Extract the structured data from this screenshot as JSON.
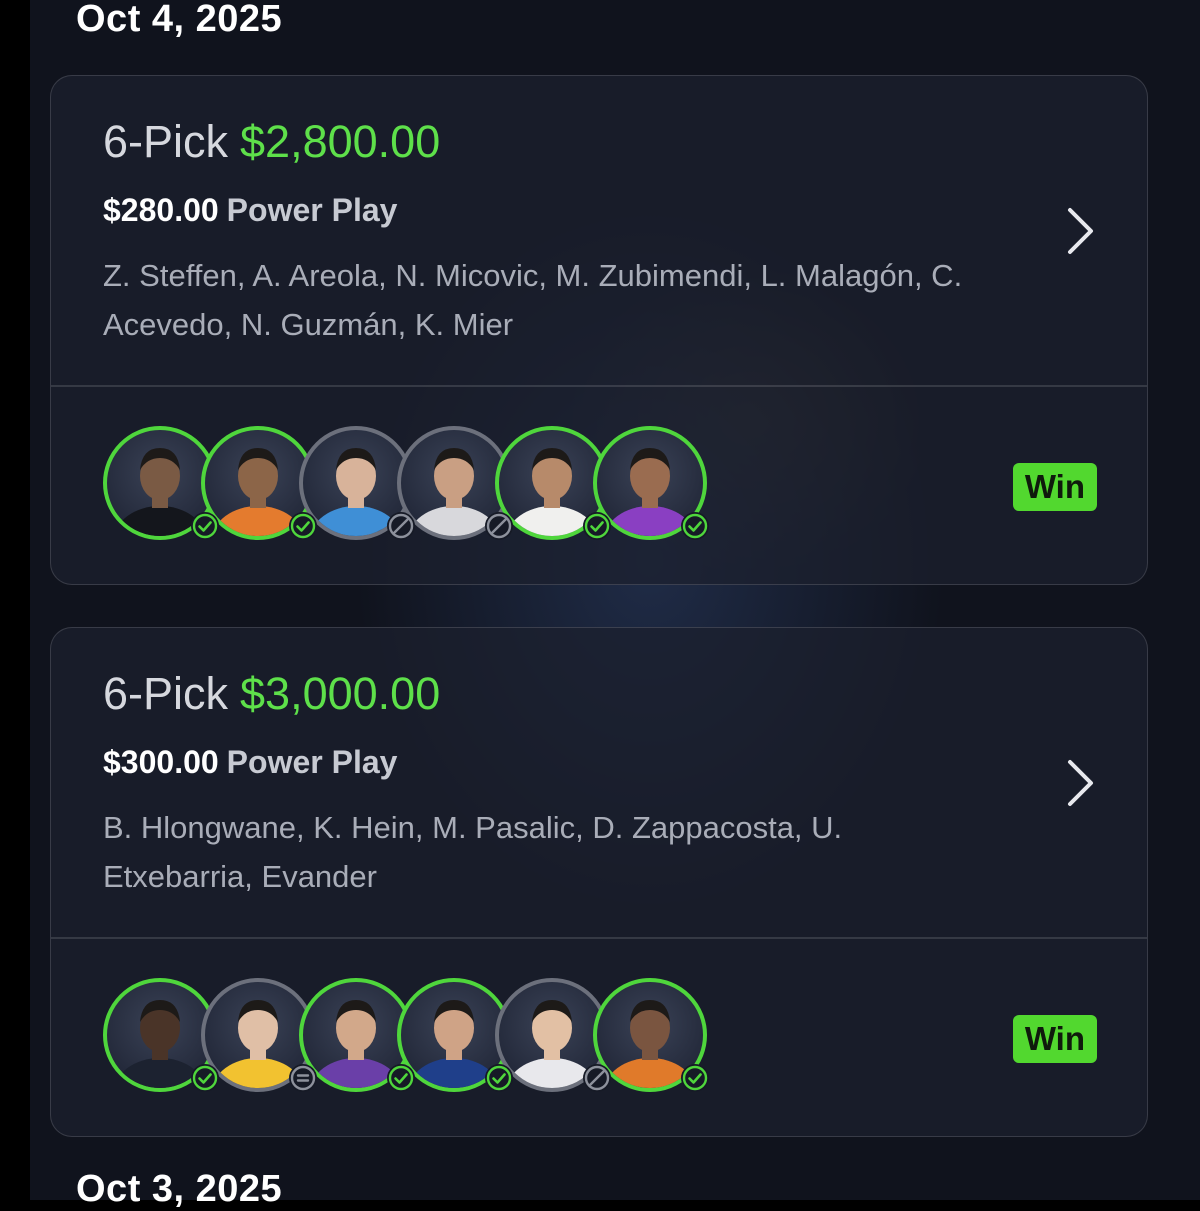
{
  "date_heading": "Oct 4, 2025",
  "next_date_heading": "Oct 3, 2025",
  "colors": {
    "accent_green": "#5ee04a",
    "win_badge": "#52d82f",
    "background": "#10131d"
  },
  "cards": [
    {
      "pick_label": "6-Pick",
      "payout": "$2,800.00",
      "entry_amount": "$280.00",
      "entry_type": "Power Play",
      "players": "Z. Steffen, A. Areola, N. Micovic, M. Zubimendi, L. Malagón, C. Acevedo, N. Guzmán, K. Mier",
      "result": "Win",
      "avatars": [
        {
          "status": "win",
          "ring": "green",
          "skin": "#7a5a44",
          "jersey": "#14161c"
        },
        {
          "status": "win",
          "ring": "green",
          "skin": "#8c6548",
          "jersey": "#e47b2e"
        },
        {
          "status": "void",
          "ring": "grey",
          "skin": "#d8b39a",
          "jersey": "#3f8fd6"
        },
        {
          "status": "void",
          "ring": "grey",
          "skin": "#c99f83",
          "jersey": "#d8d8dc"
        },
        {
          "status": "win",
          "ring": "green",
          "skin": "#b78a6a",
          "jersey": "#f0f0ee"
        },
        {
          "status": "win",
          "ring": "green",
          "skin": "#9a6c50",
          "jersey": "#8a3fc2"
        }
      ]
    },
    {
      "pick_label": "6-Pick",
      "payout": "$3,000.00",
      "entry_amount": "$300.00",
      "entry_type": "Power Play",
      "players": "B. Hlongwane, K. Hein, M. Pasalic, D. Zappacosta, U. Etxebarria, Evander",
      "result": "Win",
      "avatars": [
        {
          "status": "win",
          "ring": "green",
          "skin": "#4a3428",
          "jersey": "#1c2230"
        },
        {
          "status": "push",
          "ring": "grey",
          "skin": "#e0bfa6",
          "jersey": "#f2c230"
        },
        {
          "status": "win",
          "ring": "green",
          "skin": "#d2a88a",
          "jersey": "#6a3fa8"
        },
        {
          "status": "win",
          "ring": "green",
          "skin": "#cfa386",
          "jersey": "#1f3f8a"
        },
        {
          "status": "void",
          "ring": "grey",
          "skin": "#e2c0a4",
          "jersey": "#e8e8ec"
        },
        {
          "status": "win",
          "ring": "green",
          "skin": "#7a5540",
          "jersey": "#e07a2a"
        }
      ]
    }
  ]
}
